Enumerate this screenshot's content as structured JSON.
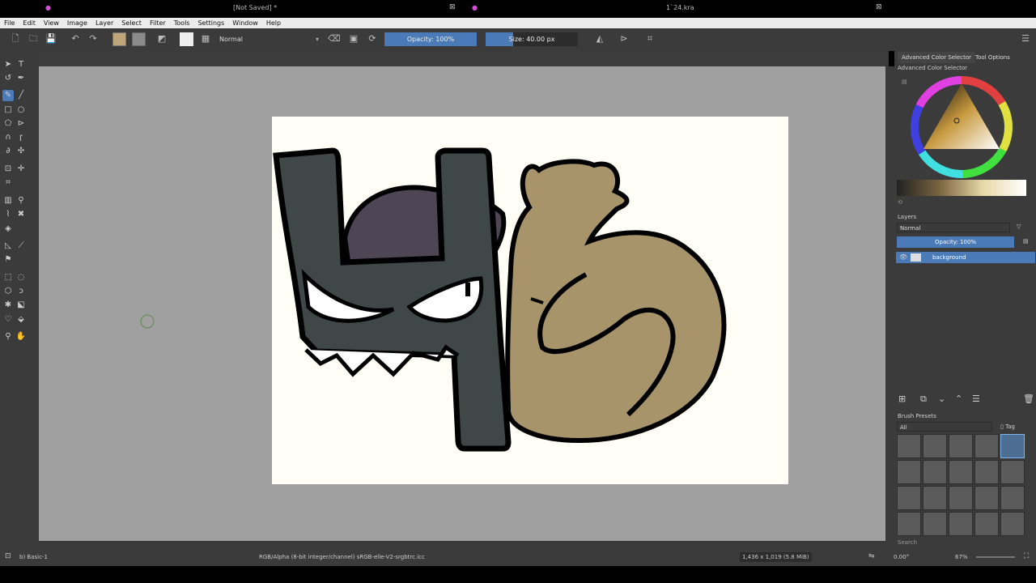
{
  "menu": [
    "File",
    "Edit",
    "View",
    "Image",
    "Layer",
    "Select",
    "Filter",
    "Tools",
    "Settings",
    "Window",
    "Help"
  ],
  "toolbar": {
    "blend_mode": "Normal",
    "opacity": "Opacity: 100%",
    "opacity_fraction": 1.0,
    "size": "Size: 40.00 px",
    "size_fraction": 0.3
  },
  "tabs": {
    "left": "[Not Saved]",
    "left_modified": "*",
    "right": "1`24.kra"
  },
  "docker": {
    "tab_color": "Advanced Color Selector",
    "tab_tool": "Tool Options",
    "color_title": "Advanced Color Selector",
    "layers_title": "Layers",
    "layer_blend": "Normal",
    "layer_opacity": "Opacity: 100%",
    "layer_name": "background",
    "presets_title": "Brush Presets",
    "presets_filter": "All",
    "presets_tag": "Tag",
    "search_placeholder": "Search"
  },
  "status": {
    "brush": "b) Basic-1",
    "color_profile": "RGB/Alpha (8-bit integer/channel)  sRGB-elle-V2-srgbtrc.icc",
    "image_size": "1,436 x 1,019 (5.8 MiB)",
    "rotation": "0.00°",
    "zoom": "67%"
  },
  "colors": {
    "accent": "#4a7ab8",
    "foreground_swatch": "#bfa57a",
    "letter_h": "#3f4847",
    "hat": "#4e4555",
    "letter_s": "#a8946a"
  }
}
